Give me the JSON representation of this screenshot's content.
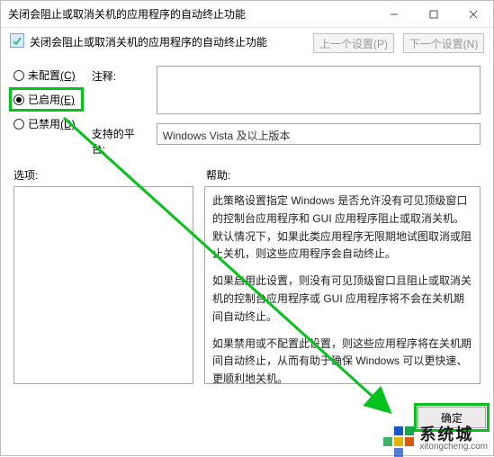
{
  "window": {
    "title": "关闭会阻止或取消关机的应用程序的自动终止功能"
  },
  "header": {
    "caption": "关闭会阻止或取消关机的应用程序的自动终止功能",
    "prev_btn": "上一个设置(P)",
    "next_btn": "下一个设置(N)"
  },
  "radios": {
    "not_configured": "未配置",
    "not_configured_hot": "(C)",
    "enabled": "已启用",
    "enabled_hot": "(E)",
    "disabled": "已禁用",
    "disabled_hot": "(D)"
  },
  "config": {
    "comment_label": "注释:",
    "platform_label": "支持的平台:",
    "platform_value": "Windows Vista 及以上版本"
  },
  "section": {
    "options_label": "选项:",
    "help_label": "帮助:"
  },
  "help": {
    "p1": "此策略设置指定 Windows 是否允许没有可见顶级窗口的控制台应用程序和 GUI 应用程序阻止或取消关机。默认情况下，如果此类应用程序无限期地试图取消或阻止关机，则这些应用程序会自动终止。",
    "p2": "如果启用此设置，则没有可见顶级窗口且阻止或取消关机的控制台应用程序或 GUI 应用程序将不会在关机期间自动终止。",
    "p3": "如果禁用或不配置此设置，则这些应用程序将在关机期间自动终止，从而有助于确保 Windows 可以更快速、更顺利地关机。"
  },
  "buttons": {
    "ok": "确定"
  },
  "watermark": {
    "cn": "系统城",
    "en": "xitongcheng.com"
  },
  "annotation": {
    "highlight_radio": "enabled",
    "highlight_button": "ok",
    "arrow_color": "#06c21c"
  }
}
